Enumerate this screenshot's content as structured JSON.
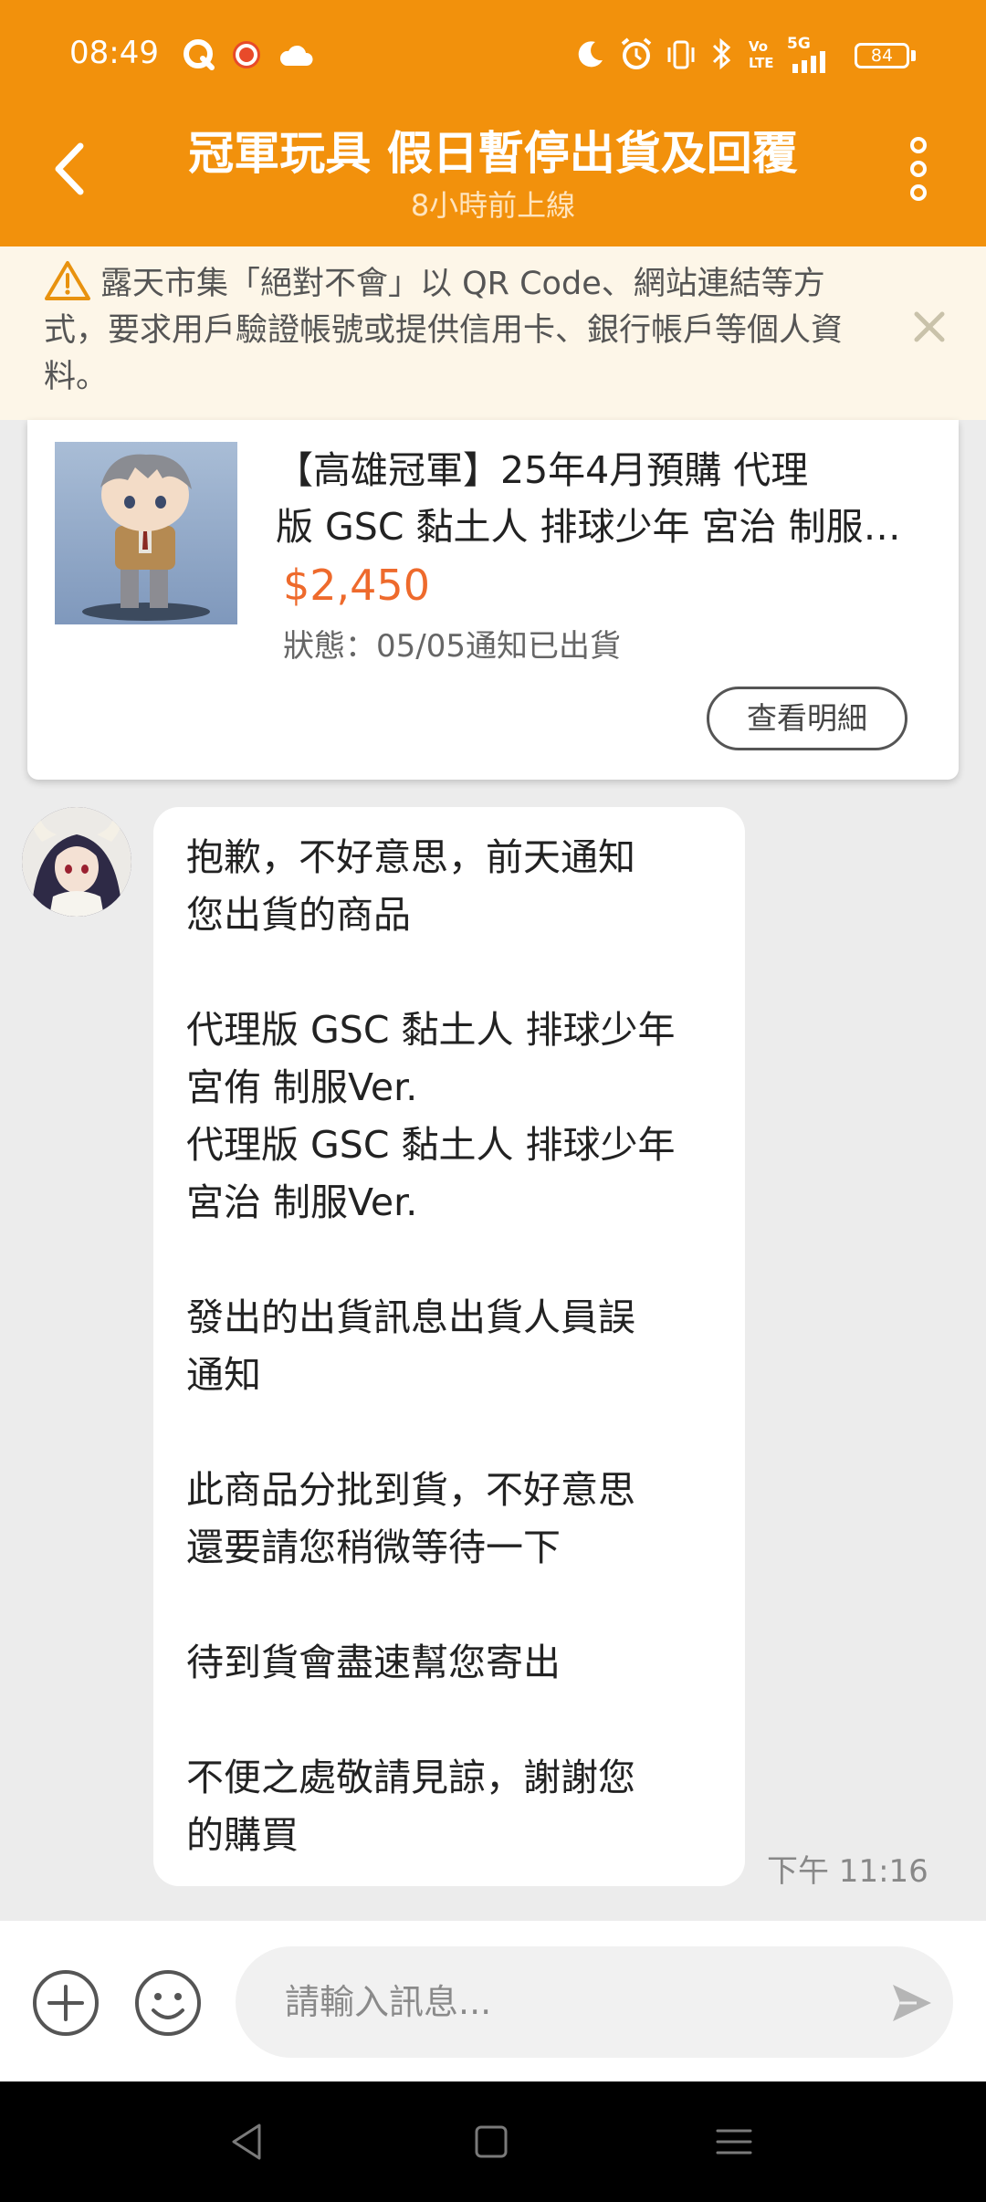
{
  "status_bar": {
    "time": "08:49",
    "network": "5G",
    "battery": "84",
    "icons": [
      "q-app-icon",
      "ring-app-icon",
      "cloud-icon",
      "moon-icon",
      "alarm-icon",
      "vibrate-icon",
      "bluetooth-icon",
      "volte-icon",
      "signal-icon",
      "battery-icon"
    ]
  },
  "header": {
    "title": "冠軍玩具 假日暫停出貨及回覆",
    "subtitle": "8小時前上線",
    "back_icon": "chevron-left-icon",
    "more_icon": "more-vertical-icon"
  },
  "warning": {
    "text": "露天市集「絕對不會」以 QR Code、網站連結等方式，要求用戶驗證帳號或提供信用卡、銀行帳戶等個人資料。",
    "icon": "warning-icon",
    "close_icon": "close-icon"
  },
  "product": {
    "title_line1": "【高雄冠軍】25年4月預購 代理",
    "title_line2": "版 GSC 黏土人 排球少年 宮治 制服Ver.",
    "price": "$2,450",
    "status": "狀態：05/05通知已出貨",
    "detail_button": "查看明細"
  },
  "message": {
    "lines": [
      "抱歉，不好意思，前天通知",
      "您出貨的商品",
      "",
      "代理版 GSC 黏土人 排球少年",
      "宮侑 制服Ver.",
      "代理版 GSC 黏土人 排球少年",
      "宮治 制服Ver.",
      "",
      "發出的出貨訊息出貨人員誤",
      "通知",
      "",
      "此商品分批到貨，不好意思",
      "還要請您稍微等待一下",
      "",
      "待到貨會盡速幫您寄出",
      "",
      "不便之處敬請見諒，謝謝您",
      "的購買"
    ],
    "time": "下午 11:16"
  },
  "input_bar": {
    "placeholder": "請輸入訊息...",
    "add_icon": "plus-circle-icon",
    "emoji_icon": "smiley-icon",
    "send_icon": "send-icon"
  },
  "nav_bar": {
    "icons": [
      "back-triangle-icon",
      "home-square-icon",
      "recents-menu-icon"
    ]
  },
  "colors": {
    "brand": "#f2910c",
    "price": "#ee6a2c",
    "warning_bg": "#fdf6e8"
  }
}
